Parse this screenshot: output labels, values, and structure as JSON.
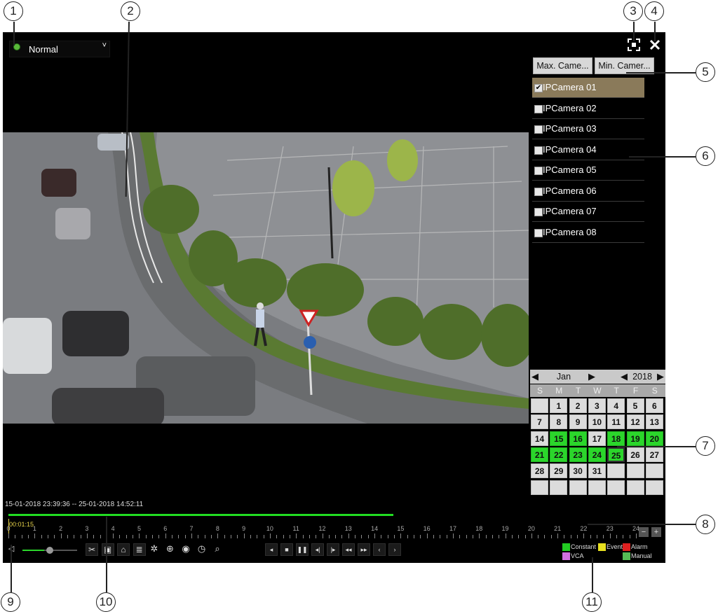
{
  "callouts": [
    "1",
    "2",
    "3",
    "4",
    "5",
    "6",
    "7",
    "8",
    "9",
    "10",
    "11"
  ],
  "playback_mode": {
    "selected": "Normal"
  },
  "window_buttons": {
    "fullscreen_icon": "fullscreen-icon",
    "close_icon": "close-icon"
  },
  "camera_panel": {
    "max_cameras_label": "Max. Came...",
    "min_cameras_label": "Min. Camer...",
    "cameras": [
      {
        "label": "IPCamera 01",
        "checked": true
      },
      {
        "label": "IPCamera 02",
        "checked": false
      },
      {
        "label": "IPCamera 03",
        "checked": false
      },
      {
        "label": "IPCamera 04",
        "checked": false
      },
      {
        "label": "IPCamera 05",
        "checked": false
      },
      {
        "label": "IPCamera 06",
        "checked": false
      },
      {
        "label": "IPCamera 07",
        "checked": false
      },
      {
        "label": "IPCamera 08",
        "checked": false
      }
    ]
  },
  "calendar": {
    "month": "Jan",
    "year": "2018",
    "weekdays": [
      "S",
      "M",
      "T",
      "W",
      "T",
      "F",
      "S"
    ],
    "weeks": [
      [
        "",
        "1",
        "2",
        "3",
        "4",
        "5",
        "6"
      ],
      [
        "7",
        "8",
        "9",
        "10",
        "11",
        "12",
        "13"
      ],
      [
        "14",
        "15",
        "16",
        "17",
        "18",
        "19",
        "20"
      ],
      [
        "21",
        "22",
        "23",
        "24",
        "25",
        "26",
        "27"
      ],
      [
        "28",
        "29",
        "30",
        "31",
        "",
        "",
        ""
      ],
      [
        "",
        "",
        "",
        "",
        "",
        "",
        ""
      ]
    ],
    "recorded_days": [
      "15",
      "16",
      "18",
      "19",
      "20",
      "21",
      "22",
      "23",
      "24",
      "25"
    ],
    "selected_day": "25",
    "record_color": "#2bd62b"
  },
  "timeline": {
    "range_text": "15-01-2018 23:39:36 -- 25-01-2018 14:52:11",
    "current_time": "00:01:15",
    "hour_labels": [
      "0",
      "1",
      "2",
      "3",
      "4",
      "5",
      "6",
      "7",
      "8",
      "9",
      "10",
      "11",
      "12",
      "13",
      "14",
      "15",
      "16",
      "17",
      "18",
      "19",
      "20",
      "21",
      "22",
      "23",
      "24"
    ],
    "recorded_fraction": 0.61,
    "zoom_out_label": "−",
    "zoom_in_label": "+"
  },
  "controls": {
    "volume_level": 0.4,
    "tools": [
      "clip-icon",
      "lock-icon",
      "tag-icon",
      "tag-list-icon",
      "settings-icon",
      "zoom-icon",
      "record-icon",
      "clock-icon",
      "search-icon"
    ],
    "playback": [
      {
        "name": "reverse-play-icon",
        "glyph": "◂"
      },
      {
        "name": "stop-icon",
        "glyph": "■"
      },
      {
        "name": "pause-icon",
        "glyph": "❚❚"
      },
      {
        "name": "step-back-icon",
        "glyph": "◂|"
      },
      {
        "name": "step-forward-icon",
        "glyph": "|▸"
      },
      {
        "name": "slow-icon",
        "glyph": "◂◂"
      },
      {
        "name": "fast-icon",
        "glyph": "▸▸"
      },
      {
        "name": "prev-icon",
        "glyph": "‹"
      },
      {
        "name": "next-icon",
        "glyph": "›"
      }
    ]
  },
  "legend": [
    {
      "label": "Constant",
      "color": "#22cc22"
    },
    {
      "label": "Event",
      "color": "#e8e020"
    },
    {
      "label": "Alarm",
      "color": "#dd2020"
    },
    {
      "label": "VCA",
      "color": "#d070e0"
    },
    {
      "label": "Manual",
      "color": "#55bb55"
    }
  ]
}
